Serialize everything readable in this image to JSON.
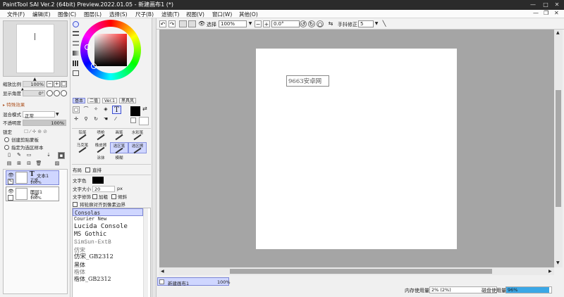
{
  "title": "PaintTool SAI Ver.2 (64bit) Preview.2022.01.05 - 新建画布1 (*)",
  "window_controls": {
    "minimize": "—",
    "maximize": "□",
    "close": "✕"
  },
  "menu": [
    "文件(F)",
    "编辑(E)",
    "图像(C)",
    "图层(L)",
    "选择(S)",
    "尺子(B)",
    "滤镜(T)",
    "视图(V)",
    "窗口(W)",
    "其他(O)"
  ],
  "navigator": {
    "zoom_label": "缩放比例",
    "zoom_value": "100%",
    "angle_label": "显示角度",
    "angle_value": "0°"
  },
  "effects": {
    "header": "特殊效果"
  },
  "layer_props": {
    "blend_label": "混合模式",
    "blend_value": "正常",
    "opacity_label": "不透明度",
    "opacity_value": "100%",
    "lock_label": "锁定",
    "clip_label": "创建剪贴蒙板",
    "select_source_label": "指定为选区样本"
  },
  "layers": [
    {
      "name": "文本1",
      "mode": "正常",
      "opacity": "100%"
    },
    {
      "name": "图层1",
      "mode": "正常",
      "opacity": "100%"
    }
  ],
  "tool_tabs": [
    "基本",
    "二值",
    "Ver.1",
    "黑具风"
  ],
  "brushes": [
    "铅笔",
    "喷枪",
    "画笔",
    "水彩笔",
    "马克笔",
    "橡皮擦",
    "选区笔",
    "选区擦",
    "涂抹",
    "模糊"
  ],
  "text_panel": {
    "layout_label": "布局",
    "vertical_label": "直排",
    "color_label": "文字色",
    "size_label": "文字大小",
    "size_value": "20",
    "size_unit": "px",
    "style_label": "文字修饰",
    "bold_label": "加粗",
    "italic_label": "倾斜",
    "snap_label": "将轮廓对齐到像素边界"
  },
  "fonts": [
    "Consolas",
    "Courier New",
    "Lucida Console",
    "MS Gothic",
    "SimSun-ExtB",
    "仿宋",
    "仿宋_GB2312",
    "黑体",
    "楷体",
    "楷体_GB2312"
  ],
  "canvas_toolbar": {
    "selection_label": "选择",
    "zoom_value": "100%",
    "angle_value": "0.0°",
    "stabilizer_label": "手抖修正",
    "stabilizer_value": "5"
  },
  "canvas_text": "9663安卓网",
  "canvas_tab": {
    "name": "新建画布1",
    "zoom": "100%"
  },
  "status": {
    "memory_label": "内存使用量",
    "memory_value": "2% (2%)",
    "disk_label": "磁盘使用量",
    "disk_value": "96%"
  },
  "colors": {
    "accent": "#cfd6ff",
    "workspace": "#a5a5a5",
    "disk_bar": "#3aa7e6"
  }
}
